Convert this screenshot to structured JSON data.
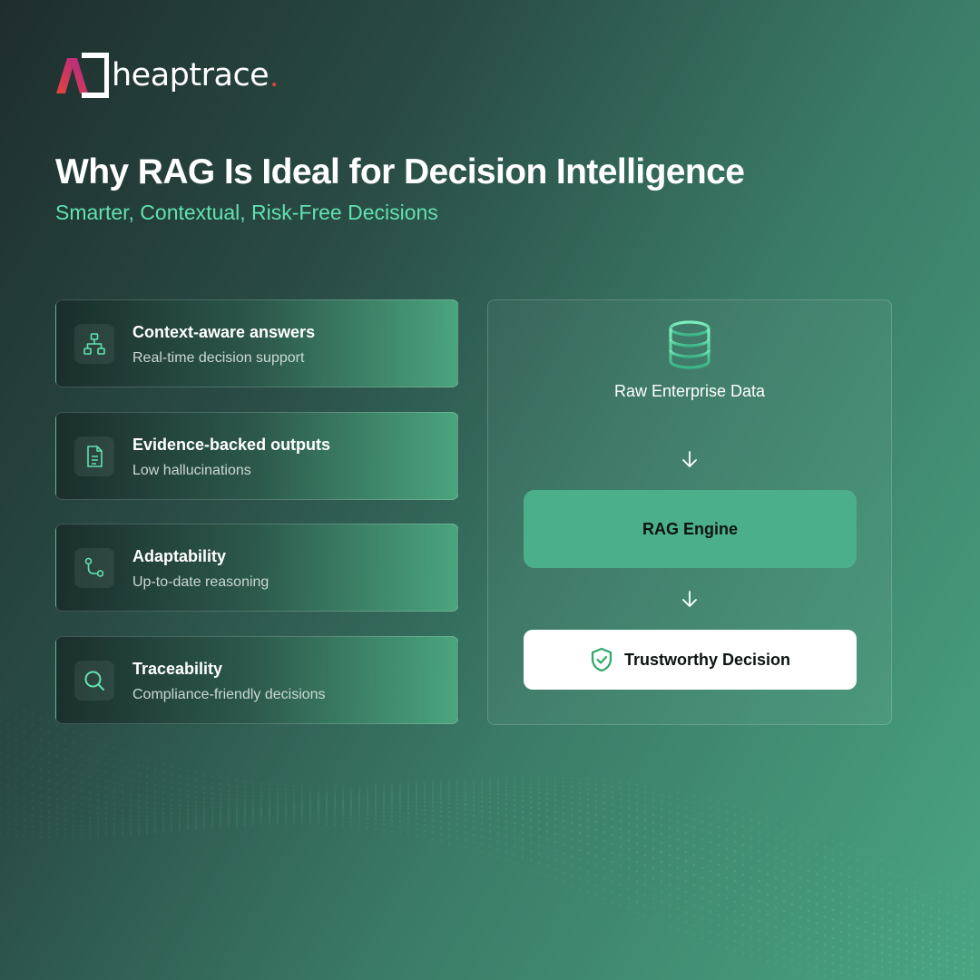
{
  "brand": {
    "name": "heaptrace",
    "dot": "."
  },
  "header": {
    "title": "Why RAG Is Ideal for Decision Intelligence",
    "subtitle": "Smarter, Contextual, Risk-Free Decisions"
  },
  "benefits": [
    {
      "title": "Context-aware answers",
      "subtitle": "Real-time decision support",
      "icon": "hierarchy-icon"
    },
    {
      "title": "Evidence-backed outputs",
      "subtitle": "Low hallucinations",
      "icon": "document-icon"
    },
    {
      "title": "Adaptability",
      "subtitle": "Up-to-date reasoning",
      "icon": "branch-icon"
    },
    {
      "title": "Traceability",
      "subtitle": "Compliance-friendly decisions",
      "icon": "search-icon"
    }
  ],
  "flow": {
    "source": "Raw Enterprise Data",
    "engine": "RAG Engine",
    "output": "Trustworthy Decision",
    "source_icon": "database-icon",
    "output_icon": "shield-check-icon"
  },
  "colors": {
    "accent": "#62e1b0",
    "engine_fill": "#4caf8b",
    "brand_gradient": [
      "#e3443d",
      "#b0288d"
    ],
    "shield": "#2ea768"
  }
}
